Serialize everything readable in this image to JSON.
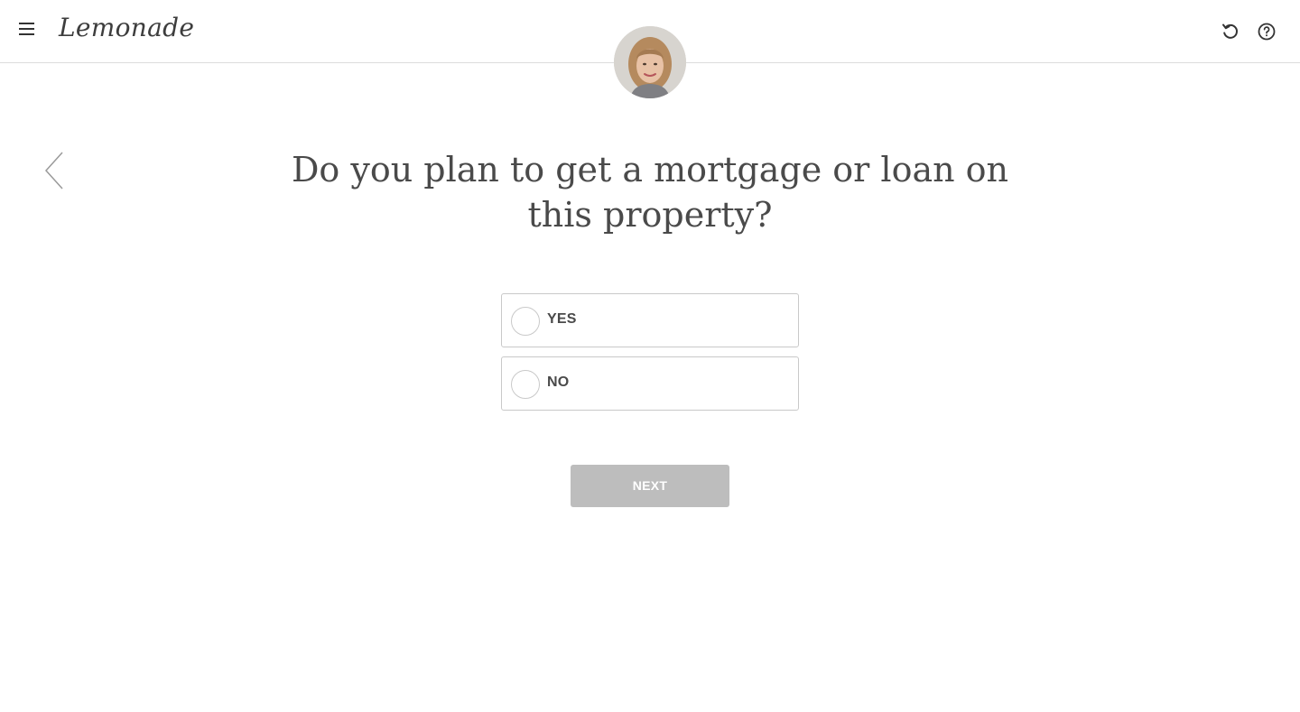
{
  "header": {
    "logo_text": "Lemonade",
    "menu_icon": "hamburger-menu-icon",
    "restart_icon": "restart-icon",
    "help_icon": "help-icon"
  },
  "assistant": {
    "avatar": "assistant-avatar"
  },
  "question": {
    "text": "Do you plan to get a mortgage or loan on this property?"
  },
  "options": [
    {
      "label": "YES",
      "selected": false
    },
    {
      "label": "NO",
      "selected": false
    }
  ],
  "actions": {
    "next_label": "NEXT",
    "next_enabled": false
  },
  "colors": {
    "text": "#4a4a4a",
    "border": "#c9c9c9",
    "next_disabled_bg": "#bdbdbd",
    "header_border": "#dcdcdc"
  }
}
